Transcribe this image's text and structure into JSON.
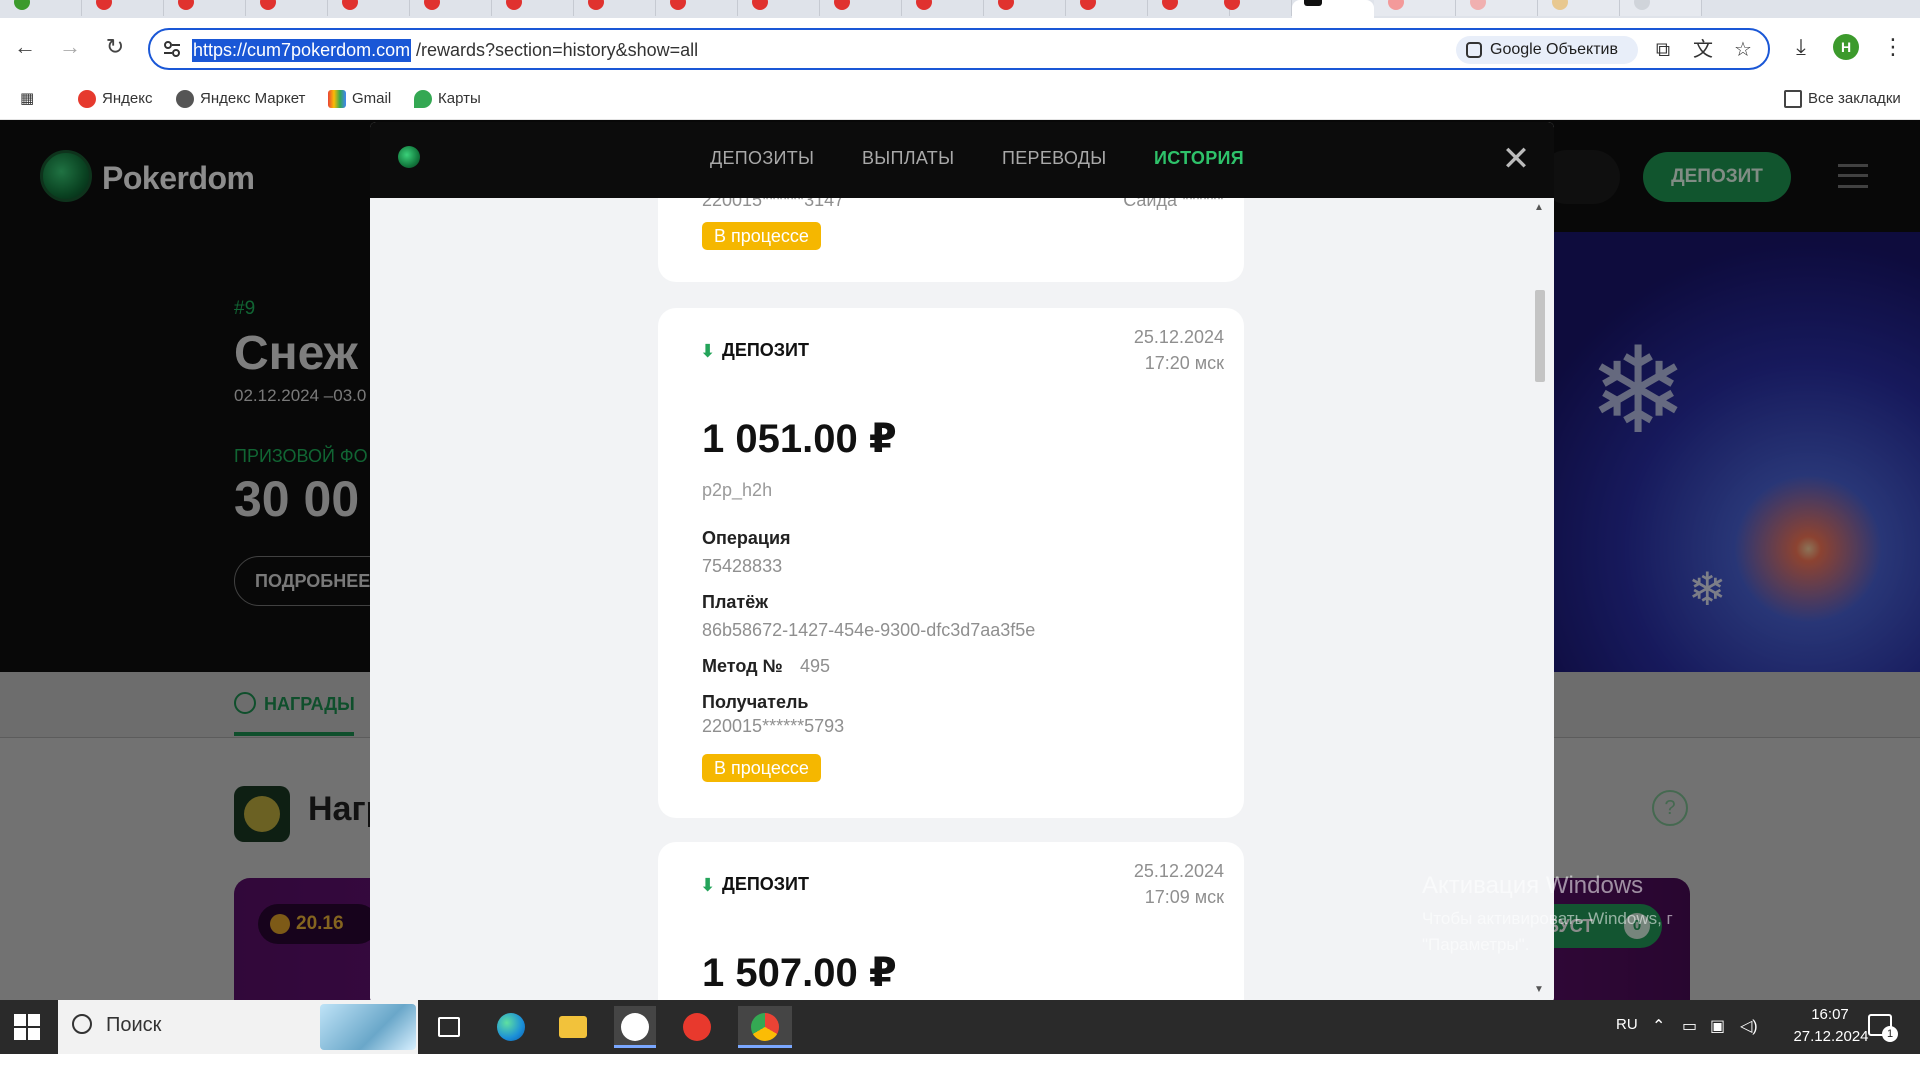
{
  "browser": {
    "url_host": "https://cum7pokerdom.com",
    "url_path": "/rewards?section=history&show=all",
    "lens_label": "Google Объектив",
    "profile_initial": "H",
    "bookmarks": [
      "Яндекс",
      "Яндекс Маркет",
      "Gmail",
      "Карты"
    ],
    "all_bookmarks": "Все закладки"
  },
  "site": {
    "logo_text": "Pokerdom",
    "deposit_button": "ДЕПОЗИТ",
    "hero": {
      "number": "#9",
      "title": "Снеж",
      "dates": "02.12.2024 –03.0",
      "prize_label": "ПРИЗОВОЙ ФО",
      "prize_value": "30 00",
      "more_button": "ПОДРОБНЕЕ"
    },
    "subnav_rewards": "НАГРАДЫ",
    "rewards_title": "Нагр",
    "help": "?",
    "promo_coins": "20.16",
    "boost_label": "БУСТ",
    "boost_count": "0"
  },
  "modal": {
    "tabs": [
      "ДЕПОЗИТЫ",
      "ВЫПЛАТЫ",
      "ПЕРЕВОДЫ",
      "ИСТОРИЯ"
    ],
    "active_tab": "ИСТОРИЯ",
    "close": "✕",
    "card_prev": {
      "partial_recipient": "220015******3147",
      "partial_name": "Саида ******",
      "status": "В процессе"
    },
    "card1": {
      "type": "ДЕПОЗИТ",
      "date": "25.12.2024",
      "time": "17:20 мск",
      "amount": "1 051.00 ₽",
      "method": "p2p_h2h",
      "operation_label": "Операция",
      "operation": "75428833",
      "payment_label": "Платёж",
      "payment": "86b58672-1427-454e-9300-dfc3d7aa3f5e",
      "method_no_label": "Метод №",
      "method_no": "495",
      "recipient_label": "Получатель",
      "recipient": "220015******5793",
      "status": "В процессе"
    },
    "card2": {
      "type": "ДЕПОЗИТ",
      "date": "25.12.2024",
      "time": "17:09 мск",
      "amount": "1 507.00 ₽"
    }
  },
  "watermark": {
    "title": "Активация Windows",
    "line1": "Чтобы активировать Windows, г",
    "line2": "\"Параметры\"."
  },
  "taskbar": {
    "search_placeholder": "Поиск",
    "lang": "RU",
    "time": "16:07",
    "date": "27.12.2024",
    "notifications": "1"
  }
}
